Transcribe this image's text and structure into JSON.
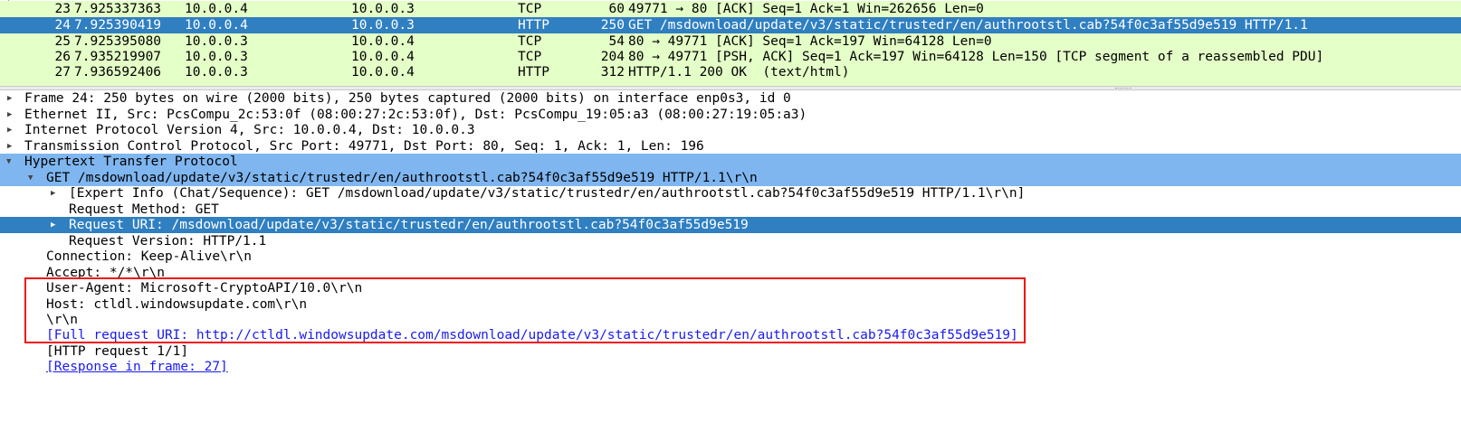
{
  "packet_list": {
    "rows": [
      {
        "no": "23",
        "time": "7.925337363",
        "src": "10.0.0.4",
        "dst": "10.0.0.3",
        "proto": "TCP",
        "len": "60",
        "info": "49771 → 80 [ACK] Seq=1 Ack=1 Win=262656 Len=0"
      },
      {
        "no": "24",
        "time": "7.925390419",
        "src": "10.0.0.4",
        "dst": "10.0.0.3",
        "proto": "HTTP",
        "len": "250",
        "info": "GET /msdownload/update/v3/static/trustedr/en/authrootstl.cab?54f0c3af55d9e519 HTTP/1.1"
      },
      {
        "no": "25",
        "time": "7.925395080",
        "src": "10.0.0.3",
        "dst": "10.0.0.4",
        "proto": "TCP",
        "len": "54",
        "info": "80 → 49771 [ACK] Seq=1 Ack=197 Win=64128 Len=0"
      },
      {
        "no": "26",
        "time": "7.935219907",
        "src": "10.0.0.3",
        "dst": "10.0.0.4",
        "proto": "TCP",
        "len": "204",
        "info": "80 → 49771 [PSH, ACK] Seq=1 Ack=197 Win=64128 Len=150 [TCP segment of a reassembled PDU]"
      },
      {
        "no": "27",
        "time": "7.936592406",
        "src": "10.0.0.3",
        "dst": "10.0.0.4",
        "proto": "HTTP",
        "len": "312",
        "info": "HTTP/1.1 200 OK  (text/html)"
      }
    ],
    "row_color": "#e4ffc7",
    "selected_color": "#2f7fc1"
  },
  "details": {
    "frame": "Frame 24: 250 bytes on wire (2000 bits), 250 bytes captured (2000 bits) on interface enp0s3, id 0",
    "ethernet": "Ethernet II, Src: PcsCompu_2c:53:0f (08:00:27:2c:53:0f), Dst: PcsCompu_19:05:a3 (08:00:27:19:05:a3)",
    "ip": "Internet Protocol Version 4, Src: 10.0.0.4, Dst: 10.0.0.3",
    "tcp": "Transmission Control Protocol, Src Port: 49771, Dst Port: 80, Seq: 1, Ack: 1, Len: 196",
    "http": "Hypertext Transfer Protocol",
    "get_line": "GET /msdownload/update/v3/static/trustedr/en/authrootstl.cab?54f0c3af55d9e519 HTTP/1.1\\r\\n",
    "expert_info": "[Expert Info (Chat/Sequence): GET /msdownload/update/v3/static/trustedr/en/authrootstl.cab?54f0c3af55d9e519 HTTP/1.1\\r\\n]",
    "request_method": "Request Method: GET",
    "request_uri": "Request URI: /msdownload/update/v3/static/trustedr/en/authrootstl.cab?54f0c3af55d9e519",
    "request_version": "Request Version: HTTP/1.1",
    "connection": "Connection: Keep-Alive\\r\\n",
    "accept": "Accept: */*\\r\\n",
    "user_agent": "User-Agent: Microsoft-CryptoAPI/10.0\\r\\n",
    "host": "Host: ctldl.windowsupdate.com\\r\\n",
    "crlf": "\\r\\n",
    "full_uri": "[Full request URI: http://ctldl.windowsupdate.com/msdownload/update/v3/static/trustedr/en/authrootstl.cab?54f0c3af55d9e519]",
    "http_request": "[HTTP request 1/1]",
    "response_in_frame": "[Response in frame: 27]"
  },
  "colors": {
    "link": "#1a1aee",
    "highlight_box": "#ee1111",
    "tree_selected": "#2f7fc1",
    "tree_expanded": "#7fb6f0"
  }
}
